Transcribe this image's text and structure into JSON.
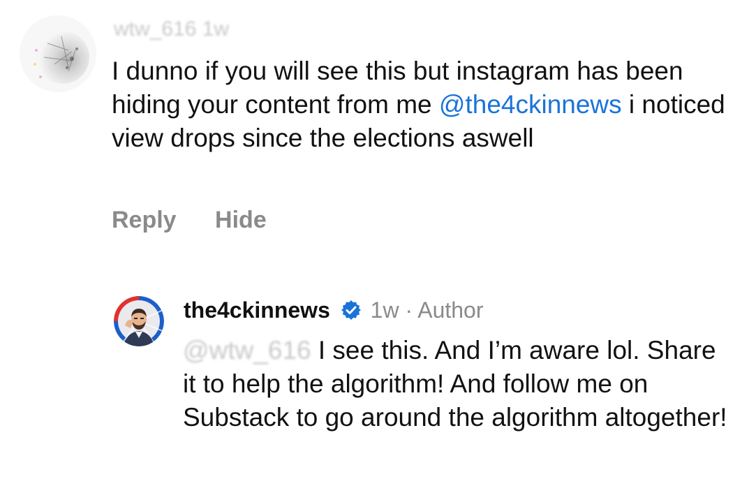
{
  "comments": [
    {
      "username": "wtw_616",
      "time": "1w",
      "text_before_mention": "I dunno if you will see this but instagram has been hiding your content from me ",
      "mention": "@the4ckinnews",
      "text_after_mention": " i noticed view drops since the elections aswell",
      "actions": {
        "reply_label": "Reply",
        "hide_label": "Hide"
      }
    }
  ],
  "reply": {
    "username": "the4ckinnews",
    "time": "1w",
    "separator": "·",
    "author_label": "Author",
    "mention": "@wtw_616",
    "text": "I see this. And I’m aware lol. Share it to help the algorithm! And follow me on Substack to go around the algorithm altogether!"
  },
  "colors": {
    "mention": "#1a73d9",
    "secondary_text": "#8a8a8a",
    "verified_badge": "#1a73d9",
    "avatar_ring_blue": "#1d5fc9",
    "avatar_ring_red": "#e2312c"
  },
  "icons": {
    "verified": "verified-badge-icon"
  }
}
